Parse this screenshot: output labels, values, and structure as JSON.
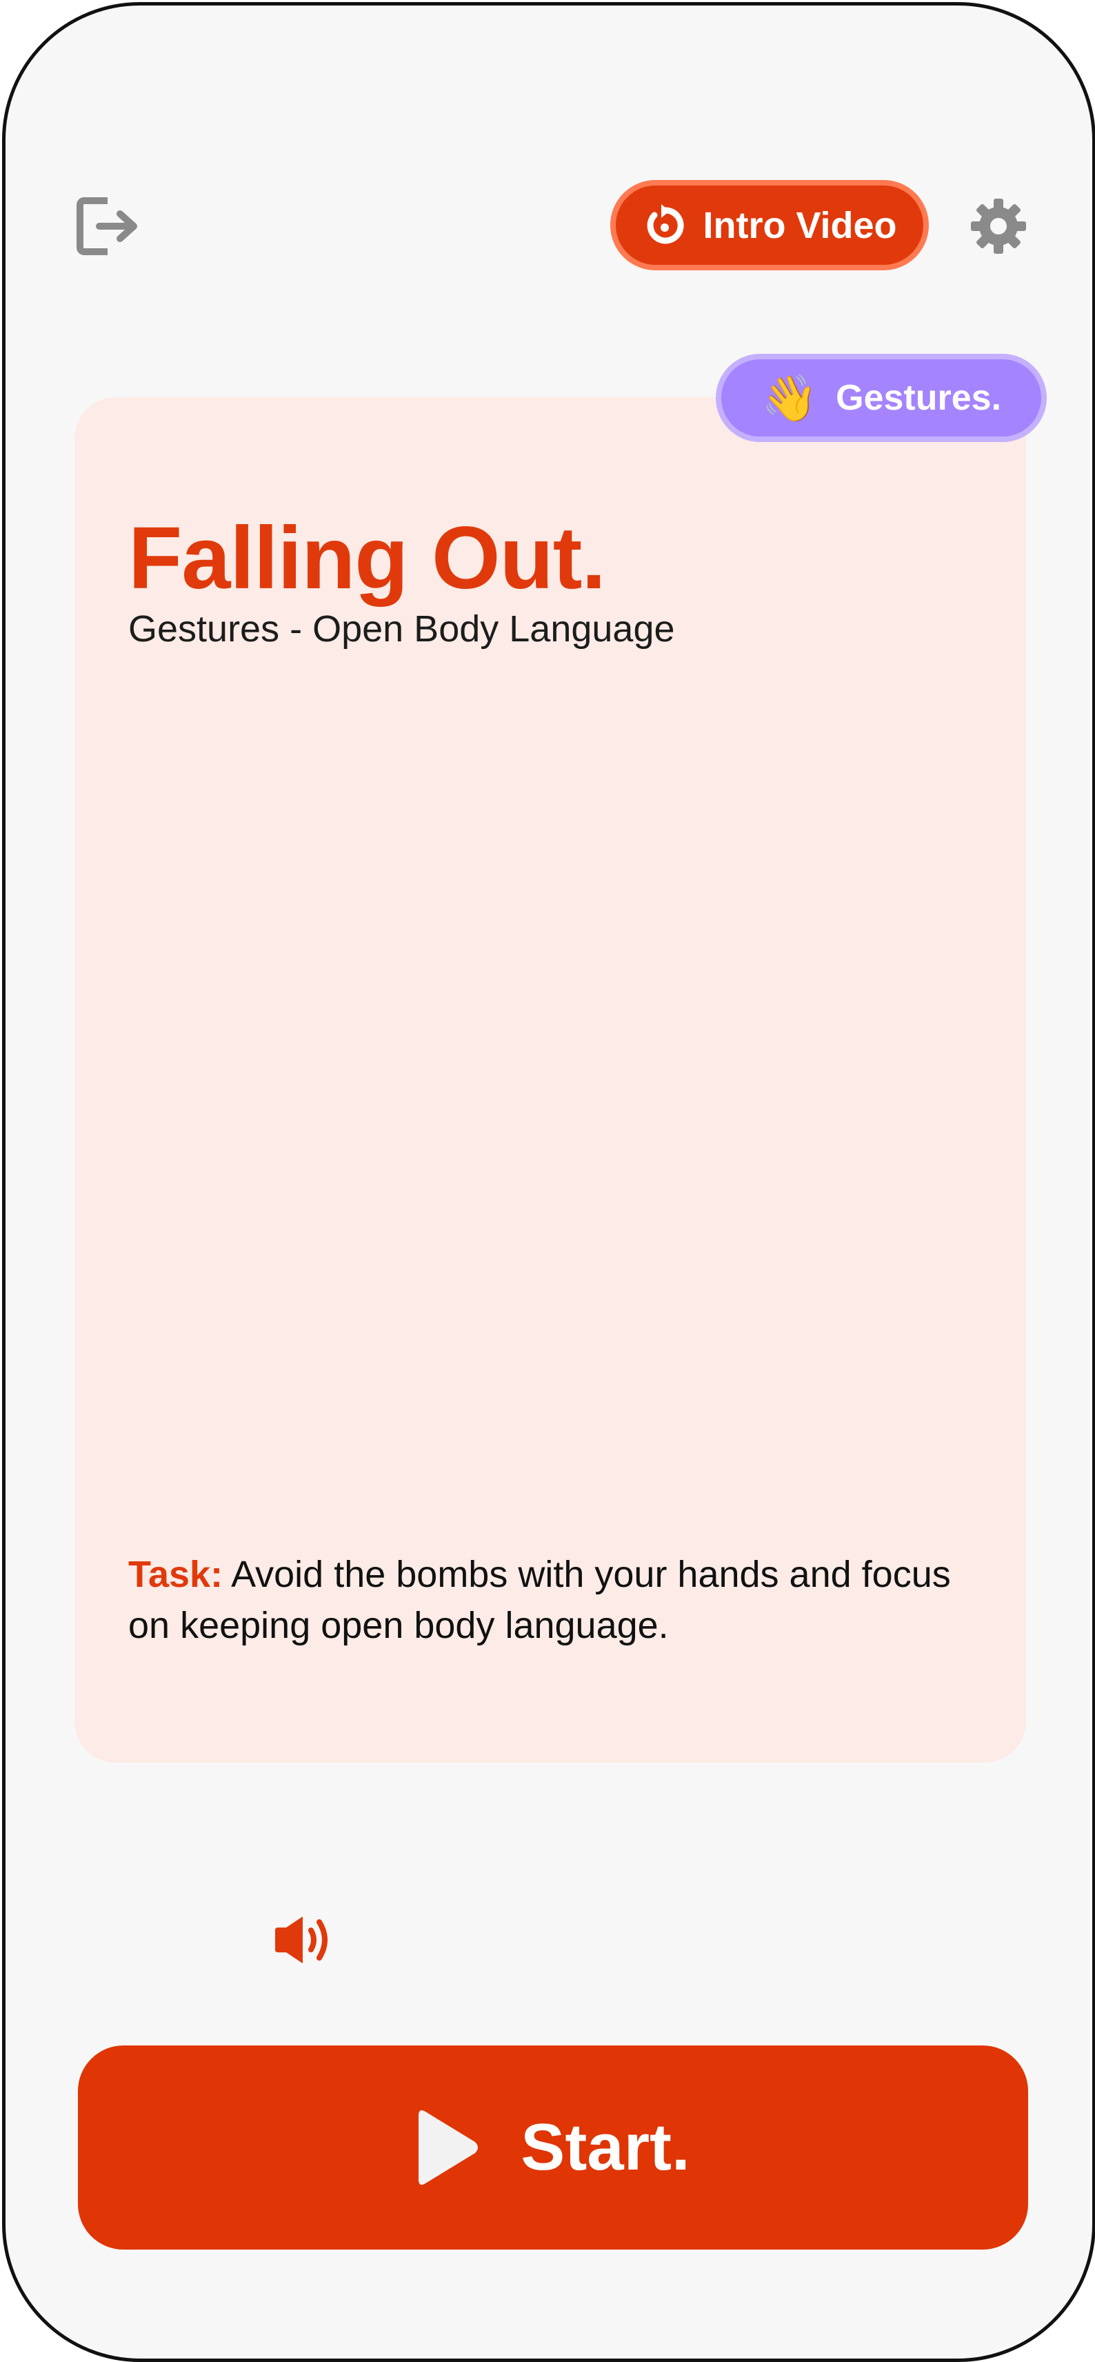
{
  "header": {
    "exit_icon": "exit-icon",
    "intro_button": {
      "label": "Intro Video",
      "icon": "replay-icon"
    },
    "settings_icon": "gear-icon"
  },
  "card": {
    "badge": {
      "emoji": "👋",
      "label": "Gestures."
    },
    "title": "Falling Out.",
    "subtitle": "Gestures - Open Body Language",
    "task": {
      "label": "Task:",
      "text": " Avoid the bombs with your hands and focus on keeping open body language."
    }
  },
  "sound_icon": "speaker-icon",
  "start_button": {
    "label": "Start.",
    "icon": "play-icon"
  },
  "colors": {
    "accent": "#e03a0c",
    "card_background": "#fcebe6",
    "badge": "#a584ff",
    "icon_gray": "#8a8a8a",
    "screen_background": "#f7f7f7"
  }
}
